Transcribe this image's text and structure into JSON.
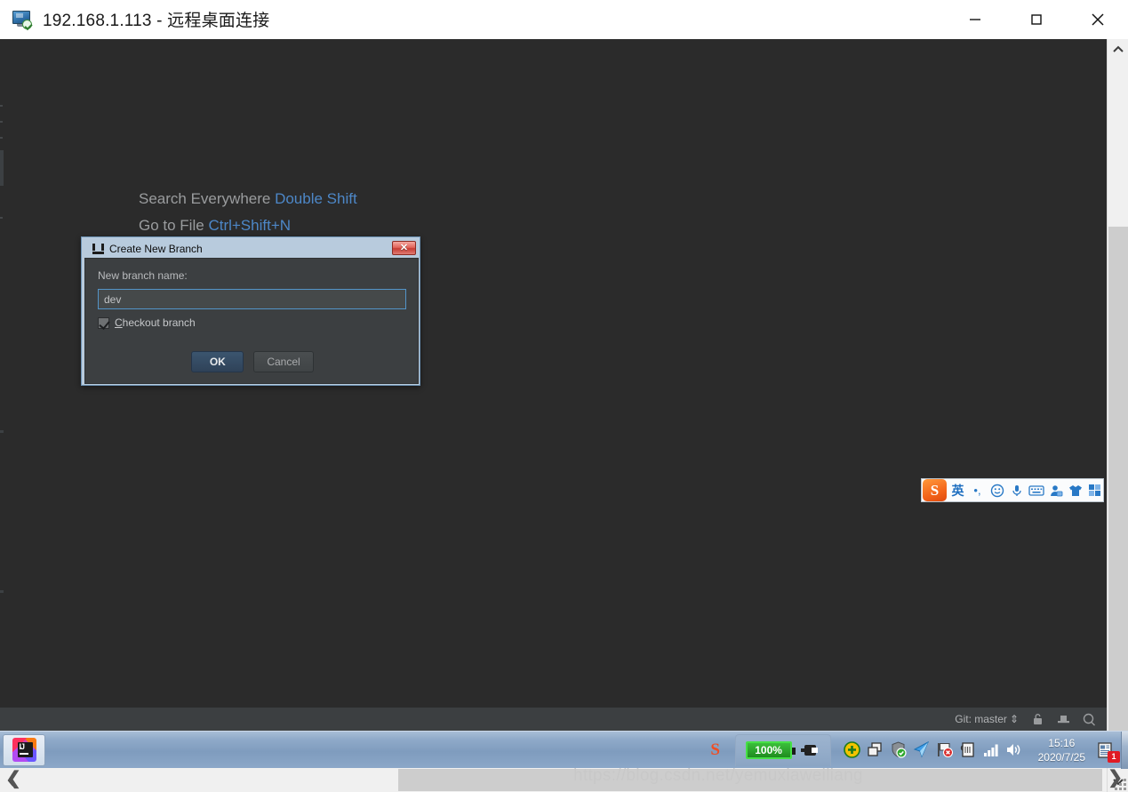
{
  "window": {
    "title": "192.168.1.113 - 远程桌面连接",
    "icon": "remote-desktop-icon",
    "controls": {
      "minimize_label": "—",
      "maximize_label": "□",
      "close_label": "✕"
    }
  },
  "remote_desktop": {
    "background_color": "#2b2b2b",
    "hints": [
      {
        "label": "Search Everywhere",
        "shortcut": "Double Shift"
      },
      {
        "label": "Go to File",
        "shortcut": "Ctrl+Shift+N"
      }
    ]
  },
  "dialog": {
    "title": "Create New Branch",
    "icon": "intellij-dialog-icon",
    "close_label": "✕",
    "field_label": "New branch name:",
    "field_value": "dev",
    "field_placeholder": "",
    "checkbox": {
      "label_accel": "C",
      "label_rest": "heckout branch",
      "checked": true
    },
    "buttons": {
      "ok": "OK",
      "cancel": "Cancel"
    },
    "accent_color": "#5394c8",
    "body_color": "#3c3f41"
  },
  "ime_toolbar": {
    "logo": "S",
    "mode_label": "英",
    "items": [
      {
        "name": "punctuation-icon",
        "glyph": "•,"
      },
      {
        "name": "emoji-icon",
        "glyph": "☺"
      },
      {
        "name": "voice-input-icon",
        "glyph": "🎤"
      },
      {
        "name": "soft-keyboard-icon",
        "glyph": "⌨"
      },
      {
        "name": "user-login-icon",
        "glyph": "👤"
      },
      {
        "name": "skin-icon",
        "glyph": "👕"
      },
      {
        "name": "toolbox-icon",
        "glyph": "▤"
      }
    ]
  },
  "ide_status_bar": {
    "git_label": "Git: master",
    "git_caret": "⇕",
    "icons": [
      {
        "name": "lock-icon"
      },
      {
        "name": "hat-icon"
      },
      {
        "name": "search-icon"
      }
    ]
  },
  "scrollbars": {
    "vertical": {
      "up_arrow": "⌃",
      "down_arrow": "⌄",
      "thumb_top_pct": 25,
      "thumb_height_pct": 68
    },
    "horizontal": {
      "left_arrow": "❮",
      "right_arrow": "❯",
      "thumb_left_pct": 36,
      "thumb_width_pct": 64
    }
  },
  "taskbar": {
    "tasks": [
      {
        "name": "taskbar-item-intellij",
        "icon": "intellij-idea-icon",
        "label": ""
      }
    ],
    "tray": {
      "sogou_logo": "S",
      "battery": {
        "percent_label": "100%",
        "charging": true
      },
      "icons": [
        {
          "name": "update-icon",
          "glyph": "+"
        },
        {
          "name": "window-stack-icon",
          "glyph": "▣"
        },
        {
          "name": "security-shield-icon",
          "glyph": "✓"
        },
        {
          "name": "blue-arrow-icon",
          "glyph": "➤"
        },
        {
          "name": "flag-error-icon",
          "glyph": "⚑"
        },
        {
          "name": "clipboard-icon",
          "glyph": "✋"
        },
        {
          "name": "network-signal-icon",
          "glyph": "▁▃▅▇"
        },
        {
          "name": "volume-icon",
          "glyph": "🔊"
        }
      ],
      "clock": {
        "time": "15:16",
        "date": "2020/7/25"
      },
      "action_center": {
        "badge": "1",
        "icon": "action-center-icon"
      },
      "overflow_chevron": "⌄"
    }
  },
  "watermark": {
    "text": "https://blog.csdn.net/yemuxiaweiliang"
  }
}
